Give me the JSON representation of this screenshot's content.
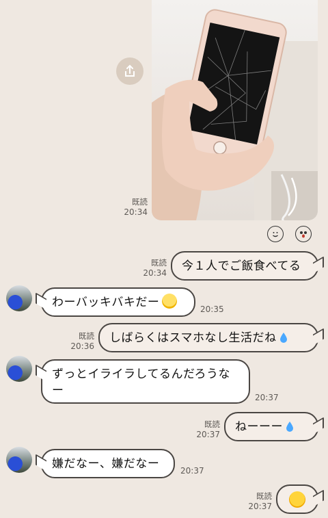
{
  "colors": {
    "background": "#efe8e1",
    "bubble_border": "#4a4643",
    "share_button": "#d9ccbf"
  },
  "photo_message": {
    "read": "既読",
    "time": "20:34"
  },
  "reactions": [
    "smile-reaction-icon",
    "surprised-reaction-icon"
  ],
  "messages": [
    {
      "side": "me",
      "text": "今１人でご飯食べてる",
      "read": "既読",
      "time": "20:34"
    },
    {
      "side": "them",
      "text": "わーバッキバキだー",
      "emoji": "scream-emoji",
      "time": "20:35"
    },
    {
      "side": "me",
      "text": "しばらくはスマホなし生活だね",
      "emoji": "droplet-emoji",
      "read": "既読",
      "time": "20:36"
    },
    {
      "side": "them",
      "line1": "ずっとイライラしてるんだろうな",
      "line2": "ー",
      "time": "20:37"
    },
    {
      "side": "me",
      "text": "ねーーー",
      "emoji": "droplet-emoji",
      "read": "既読",
      "time": "20:37"
    },
    {
      "side": "them",
      "text": "嫌だなー、嫌だなー",
      "time": "20:37"
    },
    {
      "side": "me",
      "emoji": "joy-emoji",
      "read": "既読",
      "time": "20:37"
    }
  ]
}
